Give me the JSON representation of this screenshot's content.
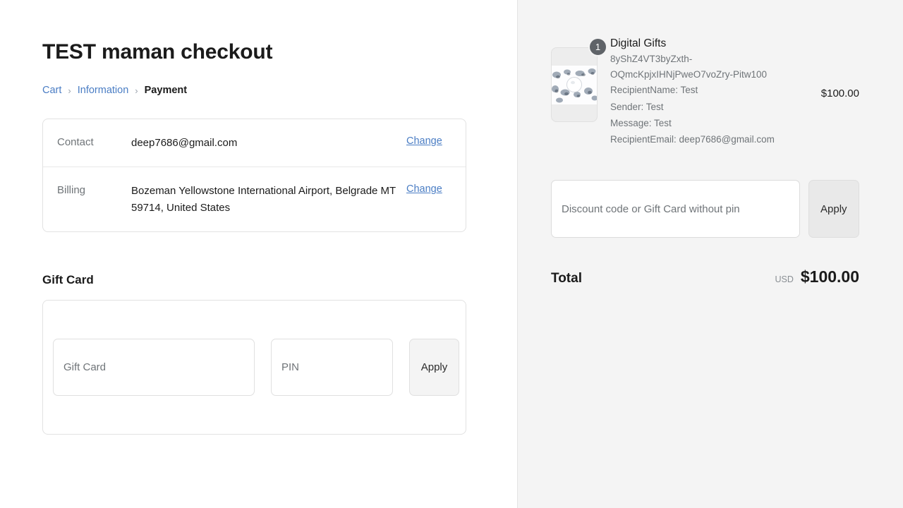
{
  "page": {
    "title": "TEST maman checkout"
  },
  "breadcrumb": {
    "items": [
      {
        "label": "Cart",
        "type": "link"
      },
      {
        "label": "Information",
        "type": "link"
      },
      {
        "label": "Payment",
        "type": "current"
      }
    ],
    "separator": "›"
  },
  "info_card": {
    "rows": [
      {
        "label": "Contact",
        "value": "deep7686@gmail.com",
        "action": "Change"
      },
      {
        "label": "Billing",
        "value": "Bozeman Yellowstone International Airport, Belgrade MT 59714, United States",
        "action": "Change"
      }
    ]
  },
  "gift_card_section": {
    "title": "Gift Card",
    "code_input": {
      "value": "",
      "placeholder": "Gift Card"
    },
    "pin_input": {
      "value": "",
      "placeholder": "PIN"
    },
    "apply_label": "Apply"
  },
  "summary": {
    "line_item": {
      "quantity": "1",
      "title": "Digital Gifts",
      "variant": "8yShZ4VT3byZxth-OQmcKpjxIHNjPweO7voZry-Pitw100",
      "properties": [
        "RecipientName: Test",
        "Sender: Test",
        "Message: Test",
        "RecipientEmail: deep7686@gmail.com"
      ],
      "price": "$100.00"
    },
    "discount": {
      "value": "",
      "placeholder": "Discount code or Gift Card without pin",
      "apply_label": "Apply"
    },
    "total": {
      "label": "Total",
      "currency": "USD",
      "amount": "$100.00"
    }
  },
  "colors": {
    "link": "#4a7dc4",
    "summary_background": "#f4f4f4",
    "badge_background": "#5f6368",
    "text_primary": "#1b1b1b",
    "text_muted": "#6f7478"
  }
}
